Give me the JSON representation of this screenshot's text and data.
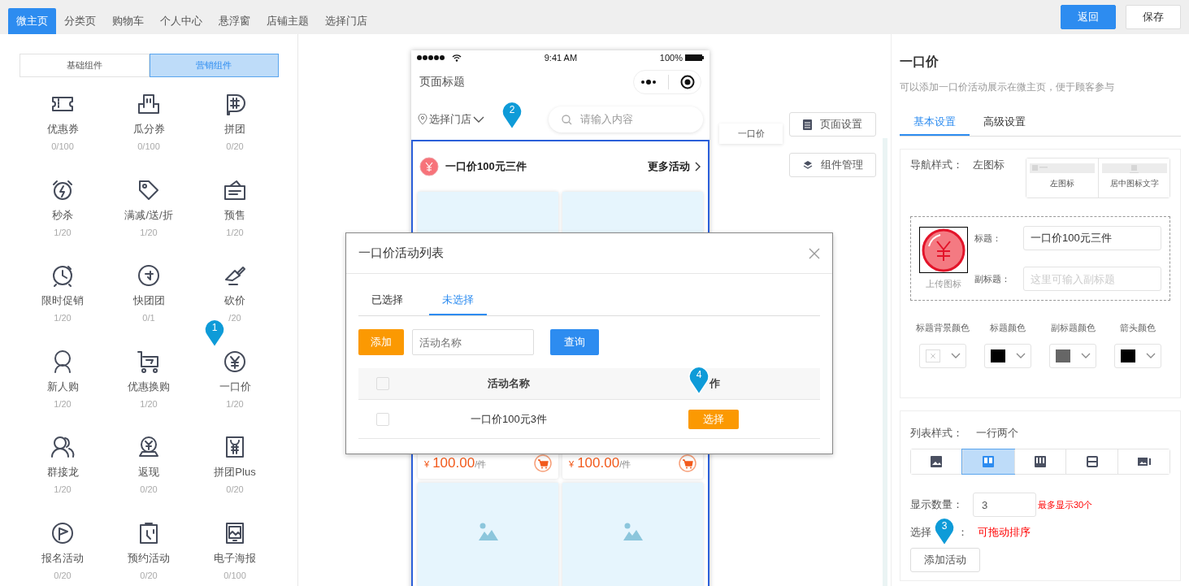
{
  "top_tabs": [
    {
      "label": "微主页",
      "selected": true
    },
    {
      "label": "分类页",
      "selected": false
    },
    {
      "label": "购物车",
      "selected": false
    },
    {
      "label": "个人中心",
      "selected": false
    },
    {
      "label": "悬浮窗",
      "selected": false
    },
    {
      "label": "店铺主题",
      "selected": false
    },
    {
      "label": "选择门店",
      "selected": false
    }
  ],
  "top_buttons": [
    {
      "label": "返回",
      "kind": "primary"
    },
    {
      "label": "保存",
      "kind": "default"
    }
  ],
  "component_tabs": [
    {
      "label": "基础组件",
      "selected": false
    },
    {
      "label": "营销组件",
      "selected": true
    }
  ],
  "components": [
    {
      "name": "优惠券",
      "count": "0/100"
    },
    {
      "name": "瓜分券",
      "count": "0/100"
    },
    {
      "name": "拼团",
      "count": "0/20"
    },
    {
      "name": "秒杀",
      "count": "1/20"
    },
    {
      "name": "满减/送/折",
      "count": "1/20"
    },
    {
      "name": "预售",
      "count": "1/20"
    },
    {
      "name": "限时促销",
      "count": "1/20"
    },
    {
      "name": "快团团",
      "count": "0/1"
    },
    {
      "name": "砍价",
      "count": "/20"
    },
    {
      "name": "新人购",
      "count": "1/20"
    },
    {
      "name": "优惠换购",
      "count": "1/20"
    },
    {
      "name": "一口价",
      "count": "1/20"
    },
    {
      "name": "群接龙",
      "count": "1/20"
    },
    {
      "name": "返现",
      "count": "0/20"
    },
    {
      "name": "拼团Plus",
      "count": "0/20"
    },
    {
      "name": "报名活动",
      "count": "0/20"
    },
    {
      "name": "预约活动",
      "count": "0/20"
    },
    {
      "name": "电子海报",
      "count": "0/100"
    }
  ],
  "phone": {
    "time": "9:41 AM",
    "battery": "100%",
    "page_title": "页面标题",
    "store": "选择门店",
    "search_placeholder": "请输入内容",
    "block": {
      "title": "一口价100元三件",
      "more": "更多活动"
    },
    "products": [
      {
        "currency": "¥",
        "price": "100.00",
        "unit": "/件"
      },
      {
        "currency": "¥",
        "price": "100.00",
        "unit": "/件"
      }
    ]
  },
  "floating_tag": "一口价",
  "side_buttons": [
    "页面设置",
    "组件管理"
  ],
  "modal": {
    "title": "一口价活动列表",
    "tabs": [
      {
        "label": "已选择",
        "selected": false
      },
      {
        "label": "未选择",
        "selected": true
      }
    ],
    "add_button": "添加",
    "search_placeholder": "活动名称",
    "query_button": "查询",
    "header_checked": false,
    "columns": [
      "活动名称",
      "作"
    ],
    "rows": [
      {
        "checked": false,
        "name": "一口价100元3件",
        "action": "选择"
      }
    ]
  },
  "settings": {
    "title": "一口价",
    "description": "可以添加一口价活动展示在微主页，便于顾客参与",
    "tabs": [
      {
        "label": "基本设置",
        "selected": true
      },
      {
        "label": "高级设置",
        "selected": false
      }
    ],
    "nav_style": {
      "label": "导航样式：",
      "value": "左图标",
      "options": [
        "左图标",
        "居中图标文字"
      ]
    },
    "icon_caption": "上传图标",
    "title_field": {
      "label": "标题：",
      "value": "一口价100元三件"
    },
    "subtitle_field": {
      "label": "副标题：",
      "placeholder": "这里可输入副标题"
    },
    "colors": [
      {
        "label": "标题背景颜色"
      },
      {
        "label": "标题颜色",
        "color": "#000000"
      },
      {
        "label": "副标题颜色",
        "color": "#666666"
      },
      {
        "label": "箭头颜色",
        "color": "#000000"
      }
    ],
    "list_style": {
      "label": "列表样式：",
      "value": "一行两个",
      "options": [
        {
          "selected": false
        },
        {
          "selected": true
        },
        {
          "selected": false
        },
        {
          "selected": false
        },
        {
          "selected": false
        }
      ]
    },
    "count_field": {
      "label": "显示数量：",
      "value": "3",
      "hint": "最多显示30个"
    },
    "select_label": [
      "选择",
      "："
    ],
    "drag_hint": "可拖动排序",
    "add_activity": "添加活动"
  },
  "markers": [
    "1",
    "2",
    "3",
    "4"
  ]
}
